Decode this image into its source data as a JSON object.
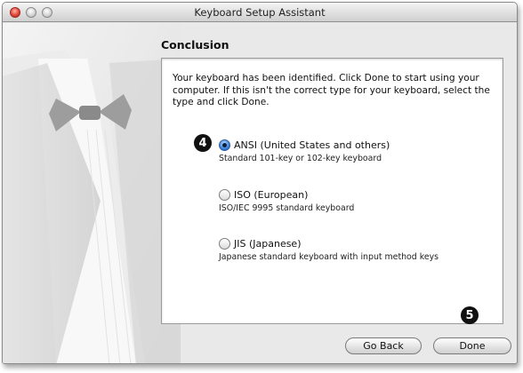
{
  "window": {
    "title": "Keyboard Setup Assistant"
  },
  "page": {
    "heading": "Conclusion",
    "intro": "Your keyboard has been identified. Click Done to start using your computer. If this isn't the correct type for your keyboard, select the type and click Done."
  },
  "options": [
    {
      "label": "ANSI (United States and others)",
      "description": "Standard 101-key or 102-key keyboard",
      "selected": true
    },
    {
      "label": "ISO (European)",
      "description": "ISO/IEC 9995 standard keyboard",
      "selected": false
    },
    {
      "label": "JIS (Japanese)",
      "description": "Japanese standard keyboard with input method keys",
      "selected": false
    }
  ],
  "callouts": {
    "four": "4",
    "five": "5"
  },
  "buttons": {
    "back": "Go Back",
    "done": "Done"
  }
}
